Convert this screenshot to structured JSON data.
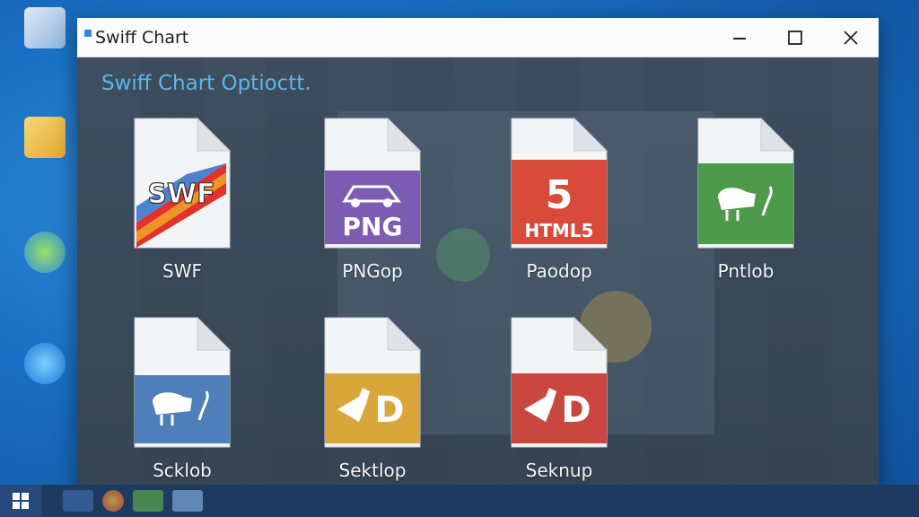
{
  "window": {
    "title": "Swiff Chart",
    "heading": "Swiff Chart Optioctt."
  },
  "tiles": [
    {
      "label": "SWF",
      "badge": "SWF",
      "badge_color": "#ffffff",
      "icon": "swf-file-icon"
    },
    {
      "label": "PNGop",
      "badge": "PNG",
      "badge_color": "#7b5cb0",
      "icon": "png-file-icon"
    },
    {
      "label": "Paodop",
      "badge": "HTML5",
      "badge_color": "#d84a3a",
      "icon": "html5-file-icon"
    },
    {
      "label": "Pntlob",
      "badge": "",
      "badge_color": "#4d9a4a",
      "icon": "green-file-icon"
    },
    {
      "label": "Scklob",
      "badge": "",
      "badge_color": "#4f7fb8",
      "icon": "blue-file-icon"
    },
    {
      "label": "Sektlop",
      "badge": "D",
      "badge_color": "#d9a63a",
      "icon": "yellow-file-icon"
    },
    {
      "label": "Seknup",
      "badge": "D",
      "badge_color": "#c9473f",
      "icon": "red-file-icon"
    }
  ],
  "colors": {
    "heading": "#5fb4e8",
    "titlebar": "#fbfbfb",
    "window_bg": "#3d4c5a",
    "desktop": "#1a6fc4"
  }
}
